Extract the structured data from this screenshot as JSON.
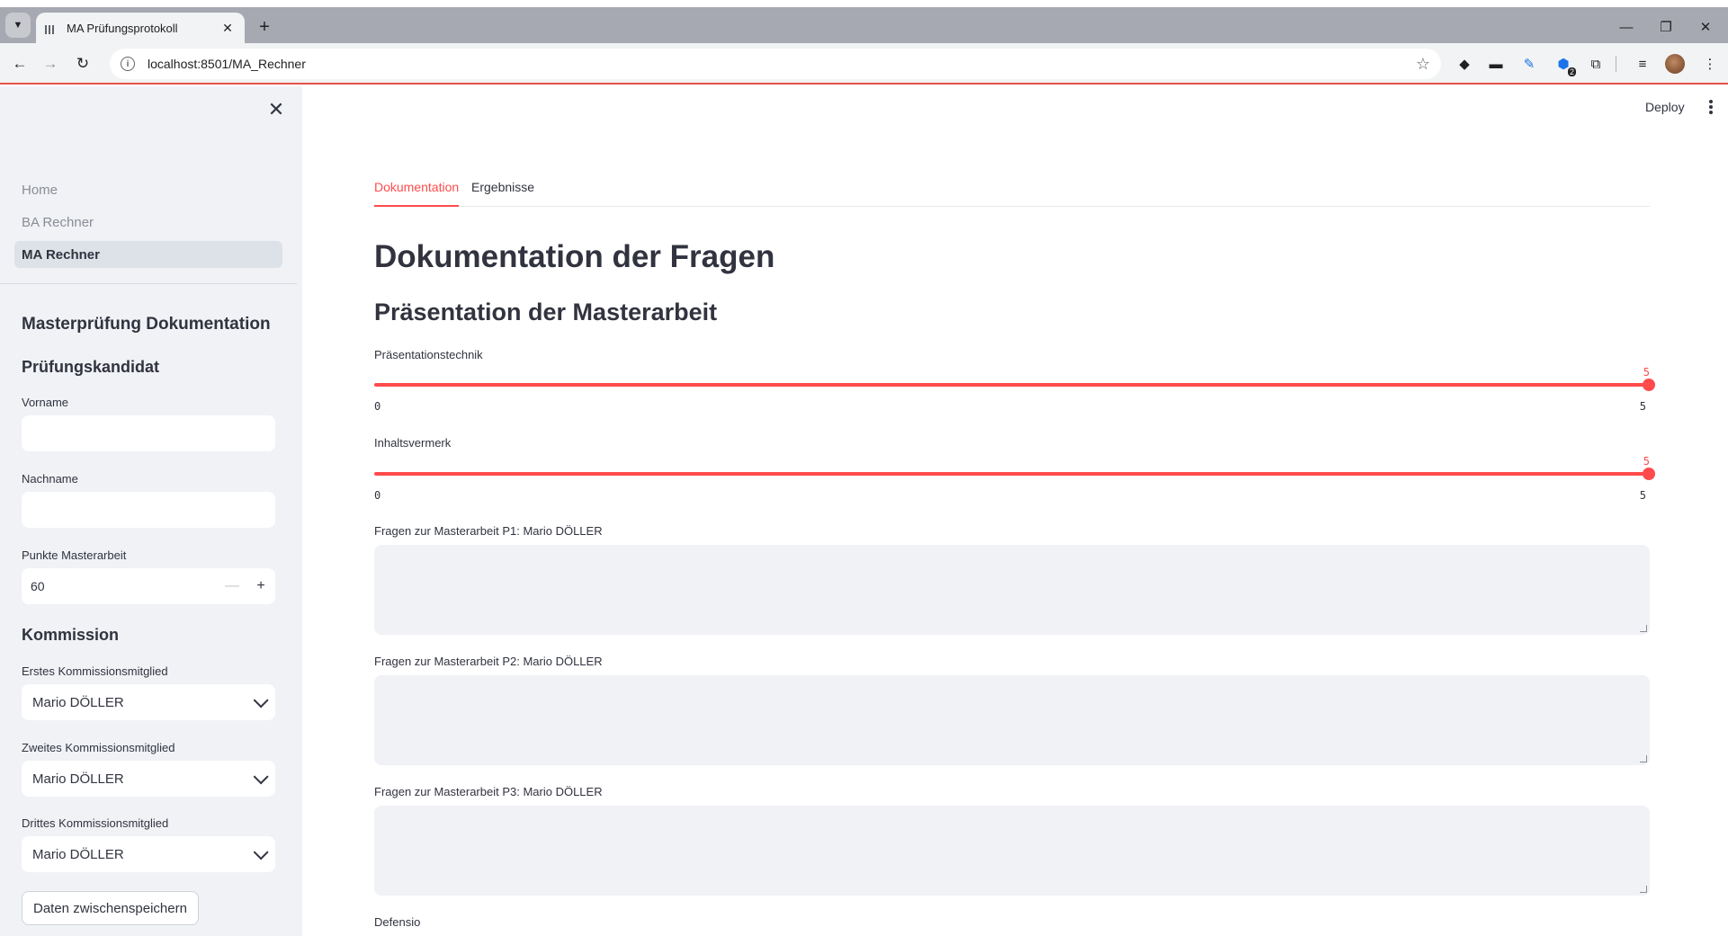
{
  "browser": {
    "tab_title": "MA Prüfungsprotokoll",
    "url": "localhost:8501/MA_Rechner",
    "extension_badge": "2"
  },
  "sidebar": {
    "nav": [
      {
        "label": "Home",
        "active": false
      },
      {
        "label": "BA Rechner",
        "active": false
      },
      {
        "label": "MA Rechner",
        "active": true
      }
    ],
    "section_title": "Masterprüfung Dokumentation",
    "candidate_heading": "Prüfungskandidat",
    "vorname_label": "Vorname",
    "vorname_value": "",
    "nachname_label": "Nachname",
    "nachname_value": "",
    "punkte_label": "Punkte Masterarbeit",
    "punkte_value": "60",
    "kommission_heading": "Kommission",
    "members": [
      {
        "label": "Erstes Kommissionsmitglied",
        "value": "Mario DÖLLER"
      },
      {
        "label": "Zweites Kommissionsmitglied",
        "value": "Mario DÖLLER"
      },
      {
        "label": "Drittes Kommissionsmitglied",
        "value": "Mario DÖLLER"
      }
    ],
    "save_button": "Daten zwischenspeichern"
  },
  "main": {
    "deploy_label": "Deploy",
    "tabs": [
      {
        "label": "Dokumentation",
        "active": true
      },
      {
        "label": "Ergebnisse",
        "active": false
      }
    ],
    "title": "Dokumentation der Fragen",
    "section_heading": "Präsentation der Masterarbeit",
    "sliders": [
      {
        "label": "Präsentationstechnik",
        "value": "5",
        "min": "0",
        "max": "5"
      },
      {
        "label": "Inhaltsvermerk",
        "value": "5",
        "min": "0",
        "max": "5"
      }
    ],
    "textareas": [
      {
        "label": "Fragen zur Masterarbeit P1: Mario DÖLLER",
        "value": ""
      },
      {
        "label": "Fragen zur Masterarbeit P2: Mario DÖLLER",
        "value": ""
      },
      {
        "label": "Fragen zur Masterarbeit P3: Mario DÖLLER",
        "value": ""
      }
    ],
    "next_label": "Defensio"
  },
  "colors": {
    "accent": "#ff4b4b",
    "sidebar_bg": "#f0f2f6",
    "text": "#31333f"
  }
}
